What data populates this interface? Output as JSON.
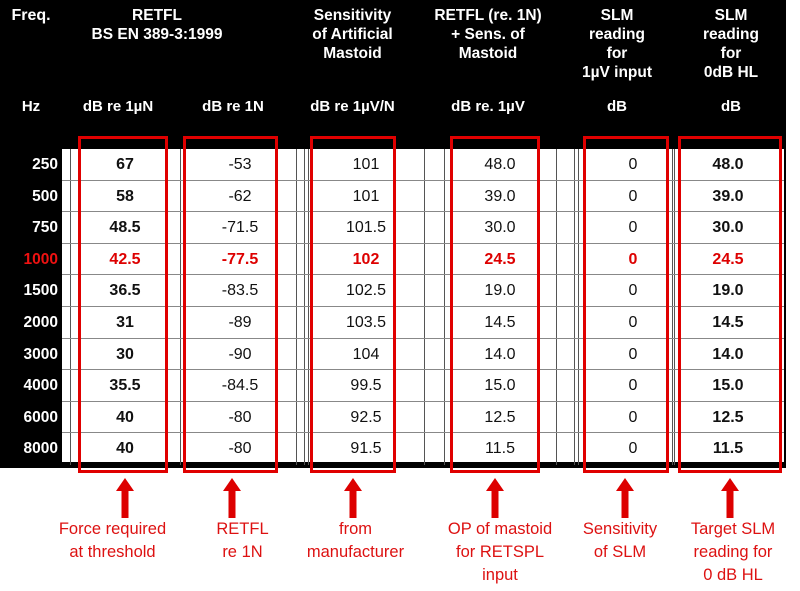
{
  "table": {
    "headers": [
      {
        "id": "freq",
        "lines": [
          "Freq."
        ]
      },
      {
        "id": "retfl_un",
        "lines": [
          "RETFL",
          "BS EN 389-3:1999"
        ]
      },
      {
        "id": "sensitivity",
        "lines": [
          "Sensitivity",
          "of Artificial",
          "Mastoid"
        ]
      },
      {
        "id": "retfl_sens",
        "lines": [
          "RETFL (re. 1N)",
          "+ Sens. of",
          "Mastoid"
        ]
      },
      {
        "id": "slm_1uv",
        "lines": [
          "SLM",
          "reading",
          "for",
          "1µV input"
        ]
      },
      {
        "id": "slm_0db",
        "lines": [
          "SLM",
          "reading",
          "for",
          "0dB HL"
        ]
      }
    ],
    "units": [
      {
        "id": "freq",
        "text": "Hz"
      },
      {
        "id": "retfl_un",
        "text": "dB  re 1µN"
      },
      {
        "id": "retfl_n",
        "text": "dB re 1N"
      },
      {
        "id": "sens",
        "text": "dB re 1µV/N"
      },
      {
        "id": "retfl_sens",
        "text": "dB re. 1µV"
      },
      {
        "id": "slm_1uv",
        "text": "dB"
      },
      {
        "id": "slm_0db",
        "text": "dB"
      }
    ],
    "columns": [
      "Hz",
      "dB re 1µN",
      "dB re 1N",
      "dB re 1µV/N",
      "dB re. 1µV",
      "dB",
      "dB"
    ],
    "rows": [
      {
        "freq": "250",
        "retfl_un": "67",
        "retfl_n": "-53",
        "sens": "101",
        "retfl_sens": "48.0",
        "slm_1uv": "0",
        "slm_0db": "48.0",
        "highlight": false
      },
      {
        "freq": "500",
        "retfl_un": "58",
        "retfl_n": "-62",
        "sens": "101",
        "retfl_sens": "39.0",
        "slm_1uv": "0",
        "slm_0db": "39.0",
        "highlight": false
      },
      {
        "freq": "750",
        "retfl_un": "48.5",
        "retfl_n": "-71.5",
        "sens": "101.5",
        "retfl_sens": "30.0",
        "slm_1uv": "0",
        "slm_0db": "30.0",
        "highlight": false
      },
      {
        "freq": "1000",
        "retfl_un": "42.5",
        "retfl_n": "-77.5",
        "sens": "102",
        "retfl_sens": "24.5",
        "slm_1uv": "0",
        "slm_0db": "24.5",
        "highlight": true
      },
      {
        "freq": "1500",
        "retfl_un": "36.5",
        "retfl_n": "-83.5",
        "sens": "102.5",
        "retfl_sens": "19.0",
        "slm_1uv": "0",
        "slm_0db": "19.0",
        "highlight": false
      },
      {
        "freq": "2000",
        "retfl_un": "31",
        "retfl_n": "-89",
        "sens": "103.5",
        "retfl_sens": "14.5",
        "slm_1uv": "0",
        "slm_0db": "14.5",
        "highlight": false
      },
      {
        "freq": "3000",
        "retfl_un": "30",
        "retfl_n": "-90",
        "sens": "104",
        "retfl_sens": "14.0",
        "slm_1uv": "0",
        "slm_0db": "14.0",
        "highlight": false
      },
      {
        "freq": "4000",
        "retfl_un": "35.5",
        "retfl_n": "-84.5",
        "sens": "99.5",
        "retfl_sens": "15.0",
        "slm_1uv": "0",
        "slm_0db": "15.0",
        "highlight": false
      },
      {
        "freq": "6000",
        "retfl_un": "40",
        "retfl_n": "-80",
        "sens": "92.5",
        "retfl_sens": "12.5",
        "slm_1uv": "0",
        "slm_0db": "12.5",
        "highlight": false
      },
      {
        "freq": "8000",
        "retfl_un": "40",
        "retfl_n": "-80",
        "sens": "91.5",
        "retfl_sens": "11.5",
        "slm_1uv": "0",
        "slm_0db": "11.5",
        "highlight": false
      }
    ]
  },
  "annotations": [
    {
      "id": "force-required",
      "lines": [
        "Force required",
        "at threshold"
      ]
    },
    {
      "id": "retfl-re-1n",
      "lines": [
        "RETFL",
        "re 1N"
      ]
    },
    {
      "id": "from-manufacturer",
      "lines": [
        "from",
        "manufacturer"
      ]
    },
    {
      "id": "op-of-mastoid",
      "lines": [
        "OP of mastoid",
        "for RETSPL",
        "input"
      ]
    },
    {
      "id": "sensitivity-slm",
      "lines": [
        "Sensitivity",
        "of SLM"
      ]
    },
    {
      "id": "target-slm",
      "lines": [
        "Target SLM",
        "reading for",
        "0 dB HL"
      ]
    }
  ],
  "colors": {
    "accent_red": "#dd0000",
    "background": "#000000",
    "table_background": "#ffffff",
    "header_text": "#ffffff"
  }
}
